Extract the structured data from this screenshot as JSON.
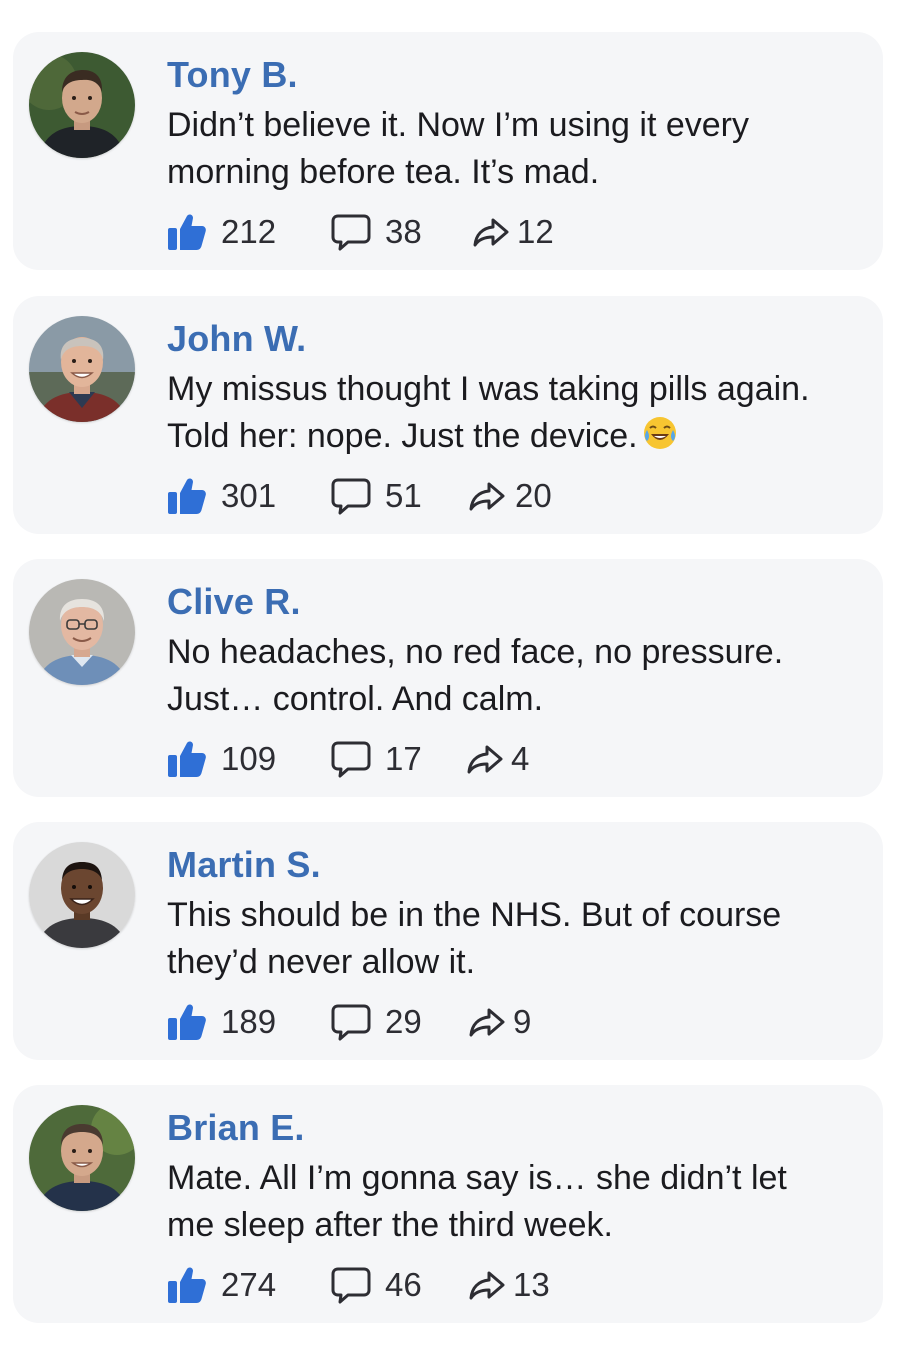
{
  "colors": {
    "name": "#3b6db3",
    "like": "#2f6fd6",
    "card_bg": "#f5f6f8",
    "text": "#1b1b1f"
  },
  "icons": {
    "like": "thumbs-up-icon",
    "comment": "comment-bubble-icon",
    "share": "share-arrow-icon",
    "emoji": "tears-of-joy-emoji"
  },
  "comments": [
    {
      "name": "Tony B.",
      "text": "Didn’t believe it. Now I’m using it every\nmorning before tea. It’s mad.",
      "likes": "212",
      "comments": "38",
      "shares": "12"
    },
    {
      "name": "John W.",
      "text": "My missus thought I was taking pills again.\nTold her: nope. Just the device.",
      "emoji": "😂",
      "likes": "301",
      "comments": "51",
      "shares": "20"
    },
    {
      "name": "Clive R.",
      "text": "No headaches, no red face, no pressure.\nJust… control. And calm.",
      "likes": "109",
      "comments": "17",
      "shares": "4"
    },
    {
      "name": "Martin S.",
      "text": "This should be in the NHS. But of course\nthey’d never allow it.",
      "likes": "189",
      "comments": "29",
      "shares": "9"
    },
    {
      "name": "Brian E.",
      "text": "Mate. All I’m gonna say is… she didn’t let\nme sleep after the third week.",
      "likes": "274",
      "comments": "46",
      "shares": "13"
    }
  ]
}
